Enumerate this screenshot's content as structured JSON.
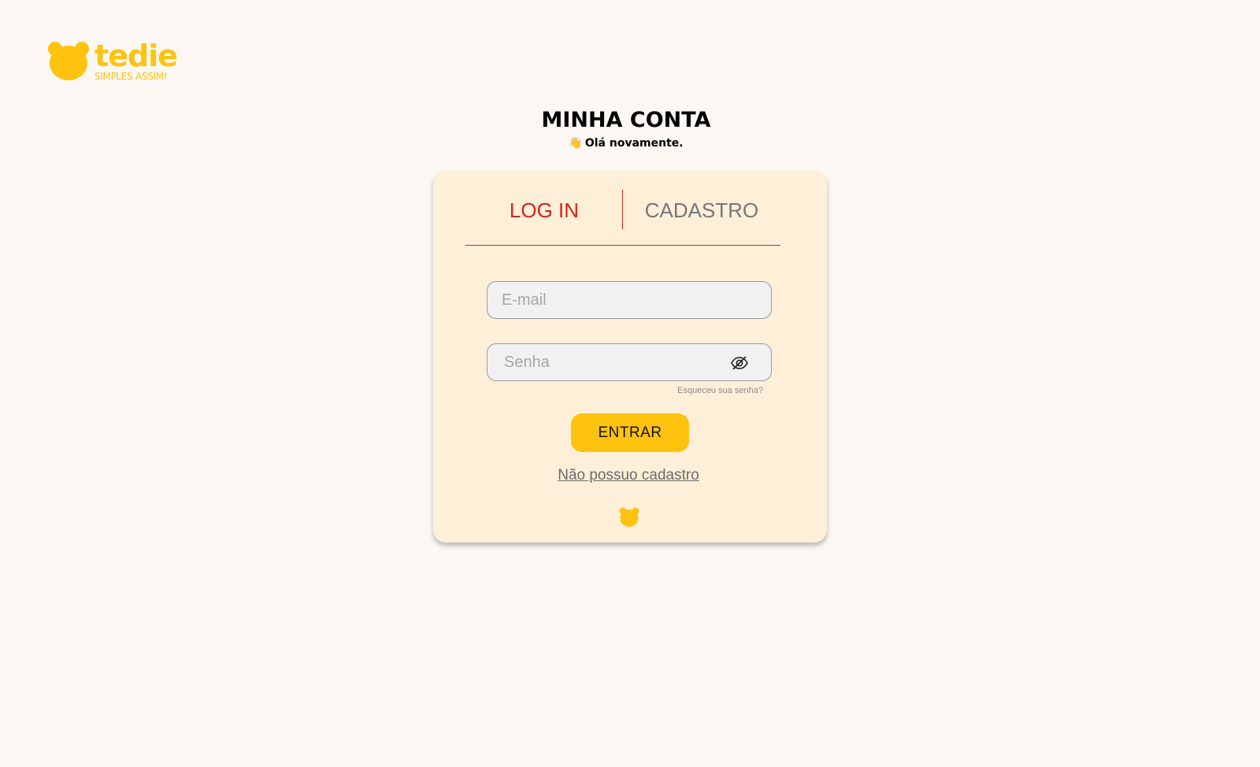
{
  "brand": {
    "name": "tedie",
    "tagline": "SIMPLES ASSIM!",
    "color": "#fdc30f",
    "logo_icon": "bear-head-icon"
  },
  "header": {
    "title": "MINHA CONTA",
    "wave_emoji": "👋",
    "subtitle": "Olá novamente."
  },
  "tabs": {
    "login": "LOG IN",
    "signup": "CADASTRO",
    "active": "login",
    "active_color": "#d6241c"
  },
  "form": {
    "email": {
      "placeholder": "E-mail",
      "value": ""
    },
    "password": {
      "placeholder": "Senha",
      "value": "",
      "toggle_icon": "eye-slash-icon"
    },
    "forgot_password": "Esqueceu sua senha?",
    "submit_label": "ENTRAR",
    "no_account_link": "Não possuo cadastro",
    "footer_icon": "bear-head-icon"
  }
}
